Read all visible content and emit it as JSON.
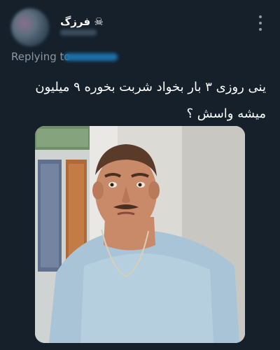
{
  "tweet": {
    "author_name": "فرزگ",
    "author_emoji": "☠",
    "replying_label": "Replying to",
    "text": "ینی روزی ۳ بار بخواد شربت بخوره ۹ میلیون\nمیشه واسش ؟"
  },
  "icons": {
    "more": "more-vertical-icon"
  }
}
